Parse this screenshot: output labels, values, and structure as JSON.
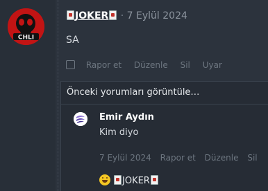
{
  "post": {
    "author": "JOKER",
    "separator": "·",
    "date": "7 Eylül 2024",
    "body": "SA",
    "actions": [
      "Rapor et",
      "Düzenle",
      "Sil",
      "Uyar"
    ]
  },
  "comments_section": {
    "load_previous": "Önceki yorumları görüntüle…",
    "comment": {
      "author": "Emir Aydın",
      "text": "Kim diyo",
      "date": "7 Eylül 2024",
      "actions": [
        "Rapor et",
        "Düzenle",
        "Sil"
      ]
    },
    "reaction": {
      "emoji_icon": "laughing-face-icon",
      "user": "JOKER"
    }
  },
  "avatar_badge_text": "CHLI",
  "colors": {
    "background": "#2a313b",
    "avatar_red": "#c21414",
    "muted_text": "#6d7680"
  }
}
